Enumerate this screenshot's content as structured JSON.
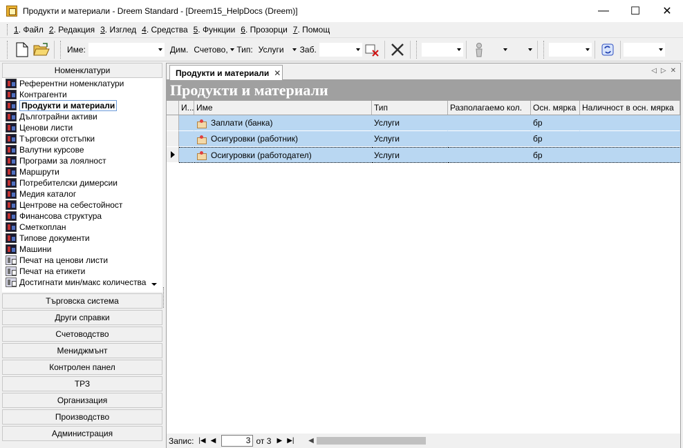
{
  "window": {
    "title": "Продукти и материали - Dreem Standard - [Dreem15_HelpDocs (Dreem)]",
    "controls": [
      "—",
      "☐",
      "✕"
    ]
  },
  "menu": [
    {
      "key": "1",
      "label": ". Файл"
    },
    {
      "key": "2",
      "label": ". Редакция"
    },
    {
      "key": "3",
      "label": ". Изглед"
    },
    {
      "key": "4",
      "label": ". Средства"
    },
    {
      "key": "5",
      "label": ". Функции"
    },
    {
      "key": "6",
      "label": ". Прозорци"
    },
    {
      "key": "7",
      "label": ". Помощ"
    }
  ],
  "toolbar": {
    "name_label": "Име:",
    "name_value": "",
    "dim_label": "Дим.",
    "dim_value": "Счетово,",
    "type_label": "Тип:",
    "type_value": "Услуги",
    "note_label": "Заб.",
    "note_value": ""
  },
  "leftnav": {
    "header": "Номенклатури",
    "items": [
      {
        "label": "Референтни номенклатури",
        "icon": "list-icon"
      },
      {
        "label": "Контрагенти",
        "icon": "list-icon"
      },
      {
        "label": "Продукти и материали",
        "icon": "list-icon",
        "selected": true
      },
      {
        "label": "Дълготрайни активи",
        "icon": "list-icon"
      },
      {
        "label": "Ценови листи",
        "icon": "list-icon"
      },
      {
        "label": "Търговски отстъпки",
        "icon": "list-icon"
      },
      {
        "label": "Валутни курсове",
        "icon": "list-icon"
      },
      {
        "label": "Програми за лоялност",
        "icon": "list-icon"
      },
      {
        "label": "Маршрути",
        "icon": "list-icon"
      },
      {
        "label": "Потребителски димерсии",
        "icon": "list-icon"
      },
      {
        "label": "Медия каталог",
        "icon": "list-icon"
      },
      {
        "label": "Центрове на себестойност",
        "icon": "list-icon"
      },
      {
        "label": "Финансова структура",
        "icon": "list-icon"
      },
      {
        "label": "Сметкоплан",
        "icon": "list-icon"
      },
      {
        "label": "Типове документи",
        "icon": "list-icon"
      },
      {
        "label": "Машини",
        "icon": "list-icon"
      },
      {
        "label": "Печат на ценови листи",
        "icon": "print-icon"
      },
      {
        "label": "Печат на етикети",
        "icon": "print-icon"
      },
      {
        "label": "Достигнати мин/макс количества",
        "icon": "print-icon"
      }
    ],
    "groups": [
      "Търговска система",
      "Други справки",
      "Счетоводство",
      "Мениджмънт",
      "Контролен панел",
      "ТРЗ",
      "Организация",
      "Производство",
      "Администрация"
    ]
  },
  "tab": {
    "label": "Продукти и материали",
    "close": "✕"
  },
  "page_title": "Продукти и материали",
  "grid": {
    "columns": [
      "И...",
      "Име",
      "Тип",
      "Разполагаемо кол.",
      "Осн. мярка",
      "Наличност в осн. мярка"
    ],
    "rows": [
      {
        "name": "Заплати (банка)",
        "type": "Услуги",
        "available": "",
        "unit": "бр",
        "stock": ""
      },
      {
        "name": "Осигуровки (работник)",
        "type": "Услуги",
        "available": "",
        "unit": "бр",
        "stock": ""
      },
      {
        "name": "Осигуровки (работодател)",
        "type": "Услуги",
        "available": "",
        "unit": "бр",
        "stock": "",
        "current": true
      }
    ]
  },
  "navigator": {
    "label": "Запис:",
    "current": "3",
    "of_total": "от 3"
  },
  "colors": {
    "selection": "#b9d7f2",
    "header_band": "#a0a0a0"
  }
}
